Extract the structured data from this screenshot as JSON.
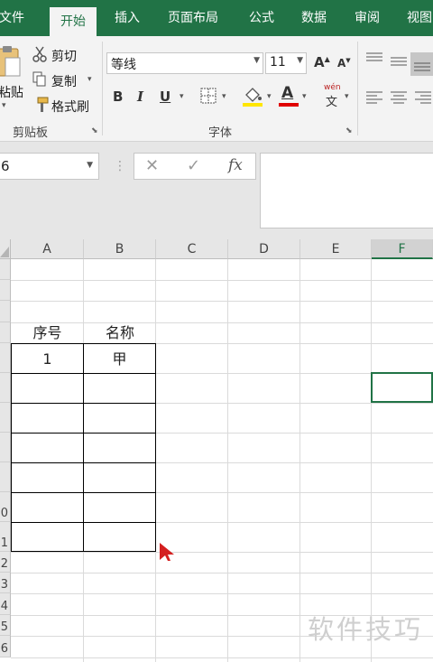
{
  "tabs": [
    "文件",
    "开始",
    "插入",
    "页面布局",
    "公式",
    "数据",
    "审阅",
    "视图"
  ],
  "clipboard": {
    "paste_label": "粘贴",
    "cut_label": "剪切",
    "copy_label": "复制",
    "format_painter_label": "格式刷",
    "group_label": "剪贴板"
  },
  "font": {
    "font_name": "等线",
    "font_size": "11",
    "group_label": "字体",
    "bold": "B",
    "italic": "I",
    "underline": "U",
    "grow": "A",
    "shrink": "A",
    "color_letter": "A",
    "phonetic_top": "wén",
    "phonetic_bottom": "文",
    "fill_color": "#ffe600",
    "font_color": "#e00000"
  },
  "formula_bar": {
    "name_box": "6",
    "fx": "fx",
    "content": ""
  },
  "columns": [
    "A",
    "B",
    "C",
    "D",
    "E",
    "F"
  ],
  "row_numbers": [
    "0",
    "1",
    "2",
    "3",
    "4",
    "5",
    "6"
  ],
  "table": {
    "headers": [
      "序号",
      "名称"
    ],
    "rows": [
      [
        "1",
        "甲"
      ],
      [
        "",
        ""
      ],
      [
        "",
        ""
      ],
      [
        "",
        ""
      ],
      [
        "",
        ""
      ],
      [
        "",
        ""
      ],
      [
        "",
        ""
      ]
    ]
  },
  "watermark": "软件技巧"
}
